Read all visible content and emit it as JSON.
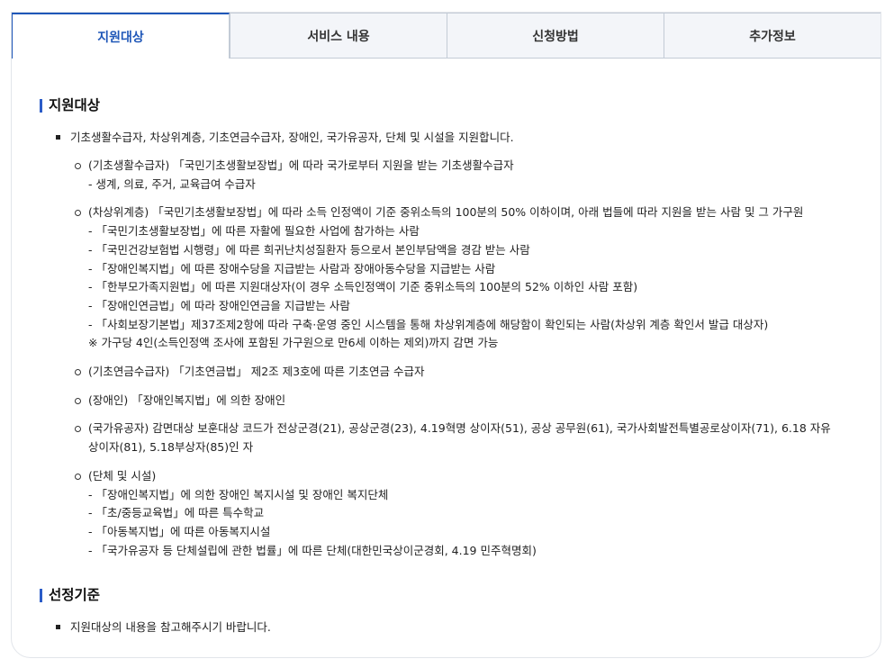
{
  "tabs": [
    {
      "label": "지원대상",
      "active": true
    },
    {
      "label": "서비스 내용",
      "active": false
    },
    {
      "label": "신청방법",
      "active": false
    },
    {
      "label": "추가정보",
      "active": false
    }
  ],
  "section1": {
    "title": "지원대상",
    "summary": "기초생활수급자, 차상위계층, 기초연금수급자, 장애인, 국가유공자, 단체 및 시설을 지원합니다.",
    "items": [
      {
        "lines": [
          "(기초생활수급자) 「국민기초생활보장법」에 따라 국가로부터 지원을 받는 기초생활수급자",
          "- 생계, 의료, 주거, 교육급여 수급자"
        ]
      },
      {
        "lines": [
          "(차상위계층) 「국민기초생활보장법」에 따라 소득 인정액이 기준 중위소득의 100분의 50% 이하이며, 아래 법들에 따라 지원을 받는 사람 및 그 가구원",
          "- 「국민기초생활보장법」에 따른 자활에 필요한 사업에 참가하는 사람",
          "- 「국민건강보험법 시행령」에 따른 희귀난치성질환자 등으로서 본인부담액을 경감 받는 사람",
          "- 「장애인복지법」에 따른 장애수당을 지급받는 사람과 장애아동수당을 지급받는 사람",
          "- 「한부모가족지원법」에 따른 지원대상자(이 경우 소득인정액이 기준 중위소득의 100분의 52% 이하인 사람 포함)",
          "- 「장애인연금법」에 따라 장애인연금을 지급받는 사람",
          "- 「사회보장기본법」제37조제2항에 따라 구축·운영 중인 시스템을 통해 차상위계층에 해당함이 확인되는 사람(차상위 계층 확인서 발급 대상자)",
          "※ 가구당 4인(소득인정액 조사에 포함된 가구원으로 만6세 이하는 제외)까지 감면 가능"
        ]
      },
      {
        "lines": [
          "(기초연금수급자) 「기초연금법」 제2조 제3호에 따른 기초연금 수급자"
        ]
      },
      {
        "lines": [
          "(장애인) 「장애인복지법」에 의한 장애인"
        ]
      },
      {
        "lines": [
          "(국가유공자) 감면대상 보훈대상 코드가 전상군경(21), 공상군경(23), 4.19혁명 상이자(51), 공상 공무원(61), 국가사회발전특별공로상이자(71), 6.18 자유 상이자(81), 5.18부상자(85)인 자"
        ],
        "wrap": true
      },
      {
        "lines": [
          "(단체 및 시설)",
          "- 「장애인복지법」에 의한 장애인 복지시설 및 장애인 복지단체",
          "- 「초/중등교육법」에 따른 특수학교",
          "- 「아동복지법」에 따른 아동복지시설",
          "- 「국가유공자 등 단체설립에 관한 법률」에 따른 단체(대한민국상이군경회, 4.19 민주혁명회)"
        ]
      }
    ]
  },
  "section2": {
    "title": "선정기준",
    "summary": "지원대상의 내용을 참고해주시기 바랍니다."
  }
}
